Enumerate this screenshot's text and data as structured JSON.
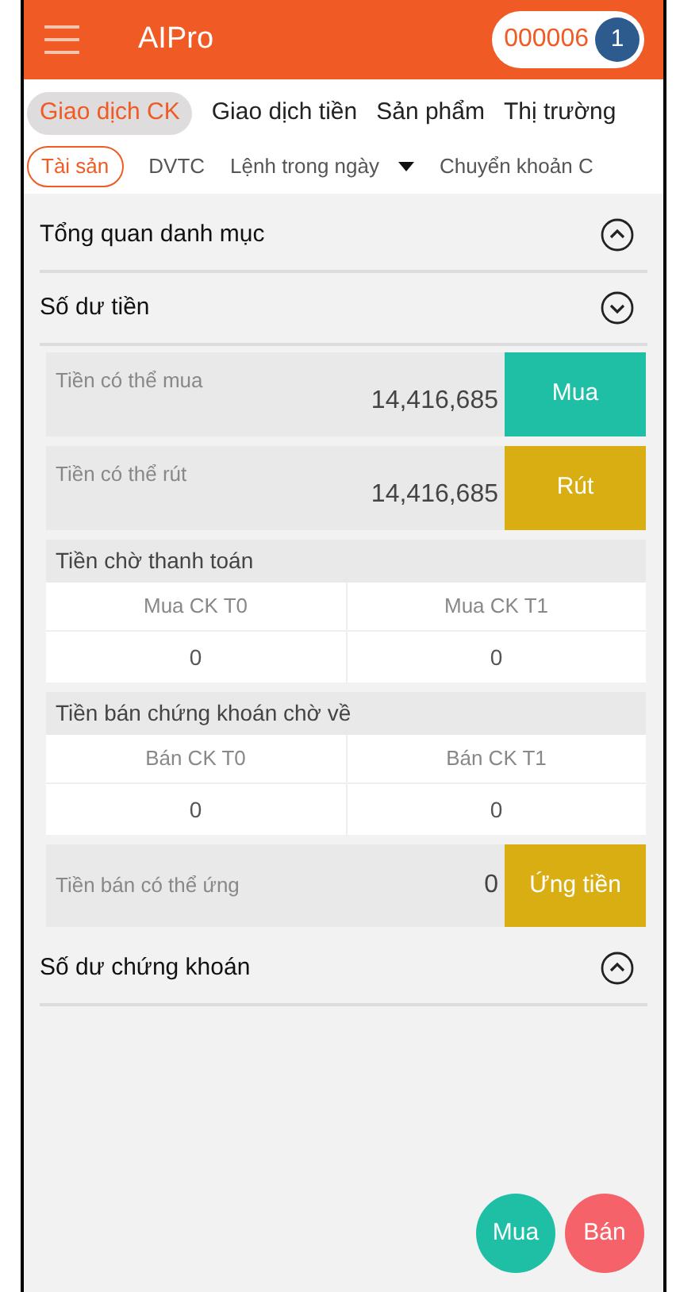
{
  "header": {
    "title": "AIPro",
    "account": "000006",
    "badge": "1"
  },
  "tabs": [
    {
      "label": "Giao dịch CK",
      "selected": true
    },
    {
      "label": "Giao dịch tiền",
      "selected": false
    },
    {
      "label": "Sản phẩm",
      "selected": false
    },
    {
      "label": "Thị trường",
      "selected": false
    }
  ],
  "subtabs": [
    {
      "label": "Tài sản",
      "selected": true,
      "dropdown": false
    },
    {
      "label": "DVTC",
      "selected": false,
      "dropdown": false
    },
    {
      "label": "Lệnh trong ngày",
      "selected": false,
      "dropdown": true
    },
    {
      "label": "Chuyển khoản C",
      "selected": false,
      "dropdown": false
    }
  ],
  "sections": [
    {
      "title": "Tổng quan danh mục",
      "expanded": false
    },
    {
      "title": "Số dư tiền",
      "expanded": true,
      "balances": [
        {
          "label": "Tiền có thể mua",
          "value": "14,416,685",
          "action": "Mua",
          "kind": "buy"
        },
        {
          "label": "Tiền có thể rút",
          "value": "14,416,685",
          "action": "Rút",
          "kind": "withdraw"
        }
      ],
      "groups": [
        {
          "title": "Tiền chờ thanh toán",
          "columns": [
            "Mua CK T0",
            "Mua CK T1"
          ],
          "values": [
            "0",
            "0"
          ]
        },
        {
          "title": "Tiền bán chứng khoán chờ về",
          "columns": [
            "Bán CK T0",
            "Bán CK T1"
          ],
          "values": [
            "0",
            "0"
          ]
        }
      ],
      "advance": {
        "label": "Tiền bán có thể ứng",
        "value": "0",
        "action": "Ứng tiền"
      }
    },
    {
      "title": "Số dư chứng khoán",
      "expanded": false
    }
  ],
  "fabs": [
    {
      "label": "Mua",
      "kind": "buy"
    },
    {
      "label": "Bán",
      "kind": "sell"
    }
  ]
}
